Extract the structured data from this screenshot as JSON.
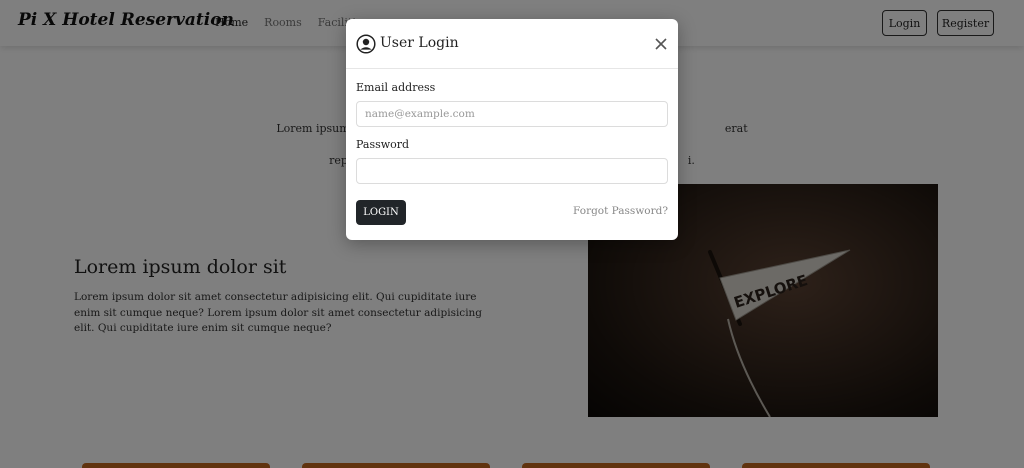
{
  "navbar": {
    "brand": "Pi X Hotel Reservation",
    "links": [
      {
        "label": "Home",
        "active": true
      },
      {
        "label": "Rooms",
        "active": false
      },
      {
        "label": "Facilities",
        "active": false
      }
    ],
    "login_label": "Login",
    "register_label": "Register"
  },
  "intro": {
    "text_left": "Lorem ipsum dolor si",
    "text_right": "erat consequuntur",
    "line2_left": "rep",
    "line2_right": "i."
  },
  "feature": {
    "title": "Lorem ipsum dolor sit",
    "text": "Lorem ipsum dolor sit amet consectetur adipisicing elit. Qui cupiditate iure enim sit cumque neque? Lorem ipsum dolor sit amet consectetur adipisicing elit. Qui cupiditate iure enim sit cumque neque?"
  },
  "photo": {
    "pennant_text": "EXPLORE"
  },
  "modal": {
    "title": "User Login",
    "email_label": "Email address",
    "email_placeholder": "name@example.com",
    "email_value": "",
    "password_label": "Password",
    "password_value": "",
    "submit_label": "LOGIN",
    "forgot_label": "Forgot Password?"
  },
  "colors": {
    "accent_bar": "#c0661f",
    "button_dark": "#212529",
    "overlay": "rgba(0,0,0,0.5)"
  }
}
